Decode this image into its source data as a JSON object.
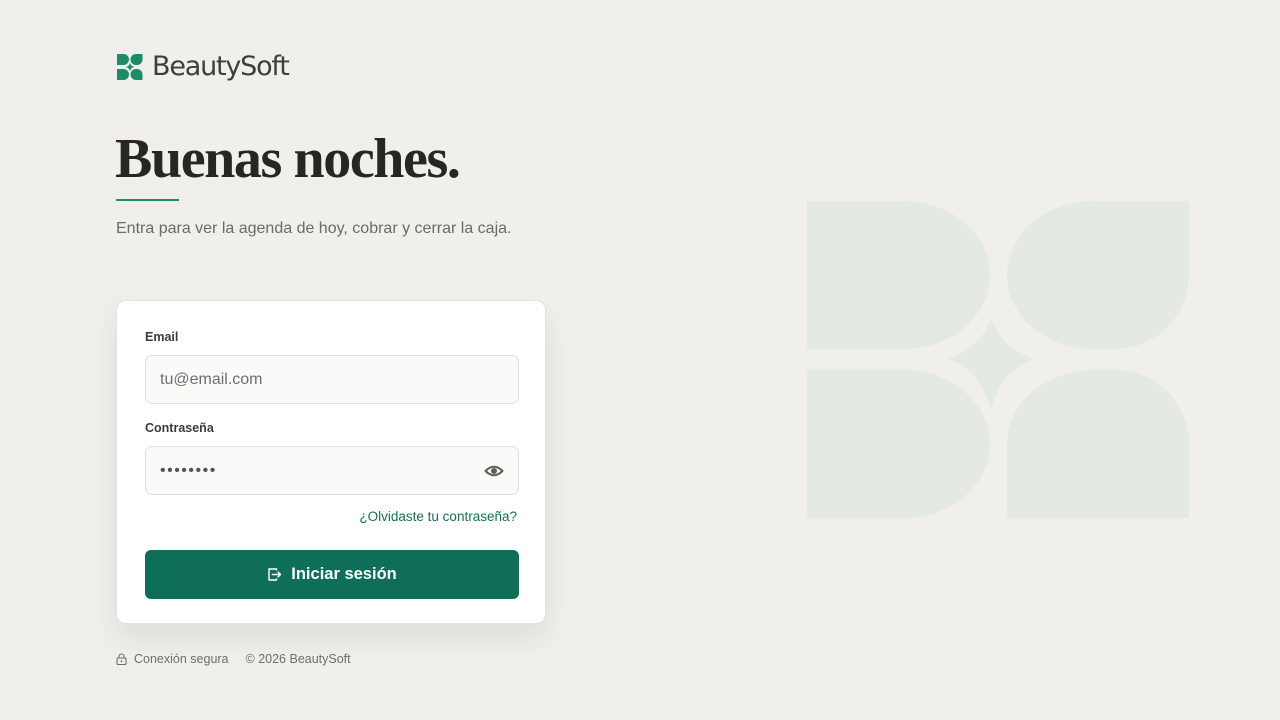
{
  "brand": {
    "name": "BeautySoft",
    "color": "#1f8c66"
  },
  "greeting": {
    "title": "Buenas noches.",
    "subtitle": "Entra para ver la agenda de hoy, cobrar y cerrar la caja."
  },
  "form": {
    "email": {
      "label": "Email",
      "placeholder": "tu@email.com",
      "value": ""
    },
    "password": {
      "label": "Contraseña",
      "masked_value": "••••••••",
      "toggle_icon": "eye-icon"
    },
    "forgot_label": "¿Olvidaste tu contraseña?",
    "submit": {
      "label": "Iniciar sesión",
      "icon": "login-icon",
      "color": "#0f6e57"
    }
  },
  "footer": {
    "secure_label": "Conexión segura",
    "secure_icon": "lock-icon",
    "copyright": "© 2026 BeautySoft"
  },
  "background": {
    "color": "#f0efeb",
    "watermark_color": "#e5e9e3"
  }
}
